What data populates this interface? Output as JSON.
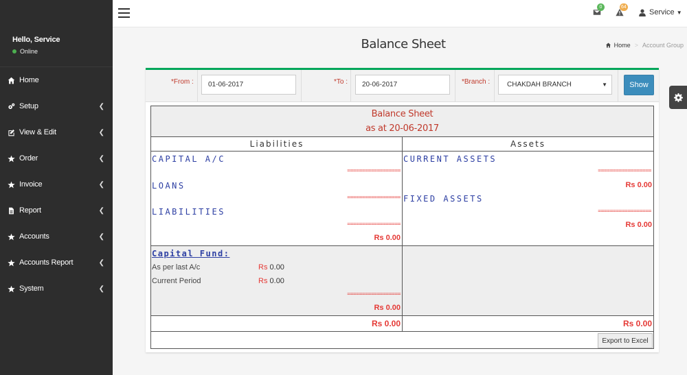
{
  "sidebar": {
    "greeting": "Hello, Service",
    "status": "Online",
    "items": [
      {
        "label": "Home",
        "icon": "home-icon",
        "has_children": false
      },
      {
        "label": "Setup",
        "icon": "cogs-icon",
        "has_children": true
      },
      {
        "label": "View & Edit",
        "icon": "edit-icon",
        "has_children": true
      },
      {
        "label": "Order",
        "icon": "star-icon",
        "has_children": true
      },
      {
        "label": "Invoice",
        "icon": "star-icon",
        "has_children": true
      },
      {
        "label": "Report",
        "icon": "file-icon",
        "has_children": true
      },
      {
        "label": "Accounts",
        "icon": "star-icon",
        "has_children": true
      },
      {
        "label": "Accounts Report",
        "icon": "star-icon",
        "has_children": true
      },
      {
        "label": "System",
        "icon": "star-icon",
        "has_children": true
      }
    ]
  },
  "topbar": {
    "mail_badge": "0",
    "alert_badge": "64",
    "user_name": "Service"
  },
  "page": {
    "title": "Balance Sheet",
    "breadcrumb_home": "Home",
    "breadcrumb_current": "Account Group"
  },
  "filter": {
    "from_label": "*From :",
    "from_value": "01-06-2017",
    "to_label": "*To :",
    "to_value": "20-06-2017",
    "branch_label": "*Branch :",
    "branch_value": "CHAKDAH BRANCH",
    "show_label": "Show"
  },
  "report": {
    "title": "Balance Sheet",
    "subtitle": "as at 20-06-2017",
    "liabilities_header": "Liabilities",
    "assets_header": "Assets",
    "liabilities": [
      {
        "group": "CAPITAL A/C",
        "separator": "==================",
        "amount": ""
      },
      {
        "group": "LOANS",
        "separator": "==================",
        "amount": ""
      },
      {
        "group": "LIABILITIES",
        "separator": "==================",
        "amount": "Rs 0.00"
      }
    ],
    "assets": [
      {
        "group": "CURRENT ASSETS",
        "separator": "==================",
        "amount": "Rs 0.00"
      },
      {
        "group": "FIXED ASSETS",
        "separator": "==================",
        "amount": "Rs 0.00"
      }
    ],
    "capital_fund": {
      "title": "Capital Fund:",
      "rows": [
        {
          "label": "As per last A/c",
          "currency": "Rs",
          "value": "0.00"
        },
        {
          "label": "Current Period",
          "currency": "Rs",
          "value": "0.00"
        }
      ],
      "separator": "==================",
      "total": "Rs 0.00"
    },
    "total_liabilities": "Rs 0.00",
    "total_assets": "Rs 0.00",
    "export_label": "Export to Excel"
  },
  "colors": {
    "sidebar_bg": "#2d2d2d",
    "accent_green": "#00a65a",
    "button_blue": "#3c8dbc",
    "amount_red": "#e53935",
    "group_blue": "#2d3fa3"
  }
}
